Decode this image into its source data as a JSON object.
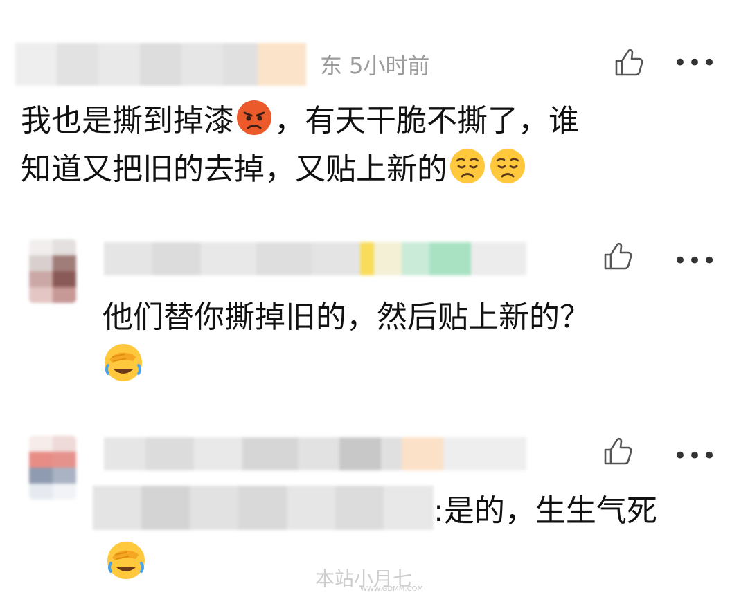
{
  "comments": [
    {
      "meta": "东 5小时前",
      "text_line1": "我也是撕到掉漆",
      "text_line1_after": "，有天干脆不撕了，谁",
      "text_line2": "知道又把旧的去掉，又贴上新的"
    },
    {
      "text": "他们替你撕掉旧的，然后贴上新的？"
    },
    {
      "text": "是的，生生气死"
    }
  ],
  "icons": {
    "like": "thumbs-up-icon",
    "more": "more-dots-icon",
    "angry": "angry-face-emoji",
    "sad": "sad-face-emoji",
    "facepalm": "facepalm-laugh-emoji"
  },
  "more_glyph": "•••",
  "watermark": {
    "main": "本站小月七",
    "sub": "WWW.GDMM.COM"
  }
}
